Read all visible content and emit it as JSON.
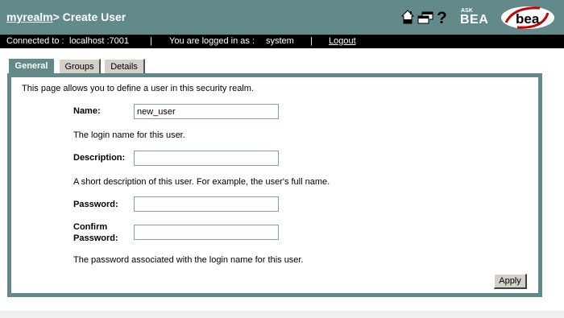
{
  "header": {
    "realm_link": "myrealm",
    "title_suffix": "> Create User",
    "icons": [
      "home-icon",
      "windows-icon",
      "help-icon"
    ],
    "ask_label": "ASK",
    "bea_label": "BEA",
    "logo_text": "bea"
  },
  "status": {
    "connected_label": "Connected to :",
    "connected_value": "localhost :7001",
    "separator": "|",
    "logged_label": "You are logged in as :",
    "logged_value": "system",
    "logout_label": "Logout"
  },
  "tabs": [
    {
      "label": "General",
      "active": true
    },
    {
      "label": "Groups",
      "active": false
    },
    {
      "label": "Details",
      "active": false
    }
  ],
  "form": {
    "intro": "This page allows you to define a user in this security realm.",
    "name_label": "Name:",
    "name_value": "new_user",
    "name_help": "The login name for this user.",
    "description_label": "Description:",
    "description_value": "",
    "description_help": "A short description of this user. For example, the user's full name.",
    "password_label": "Password:",
    "password_value": "",
    "confirm_label_1": "Confirm",
    "confirm_label_2": "Password:",
    "confirm_value": "",
    "password_help": "The password associated with the login name for this user.",
    "apply_label": "Apply"
  },
  "colors": {
    "header_bg": "#638a8a",
    "status_bg": "#000000",
    "panel_border": "#638a8a",
    "logo_red": "#cc0000"
  }
}
